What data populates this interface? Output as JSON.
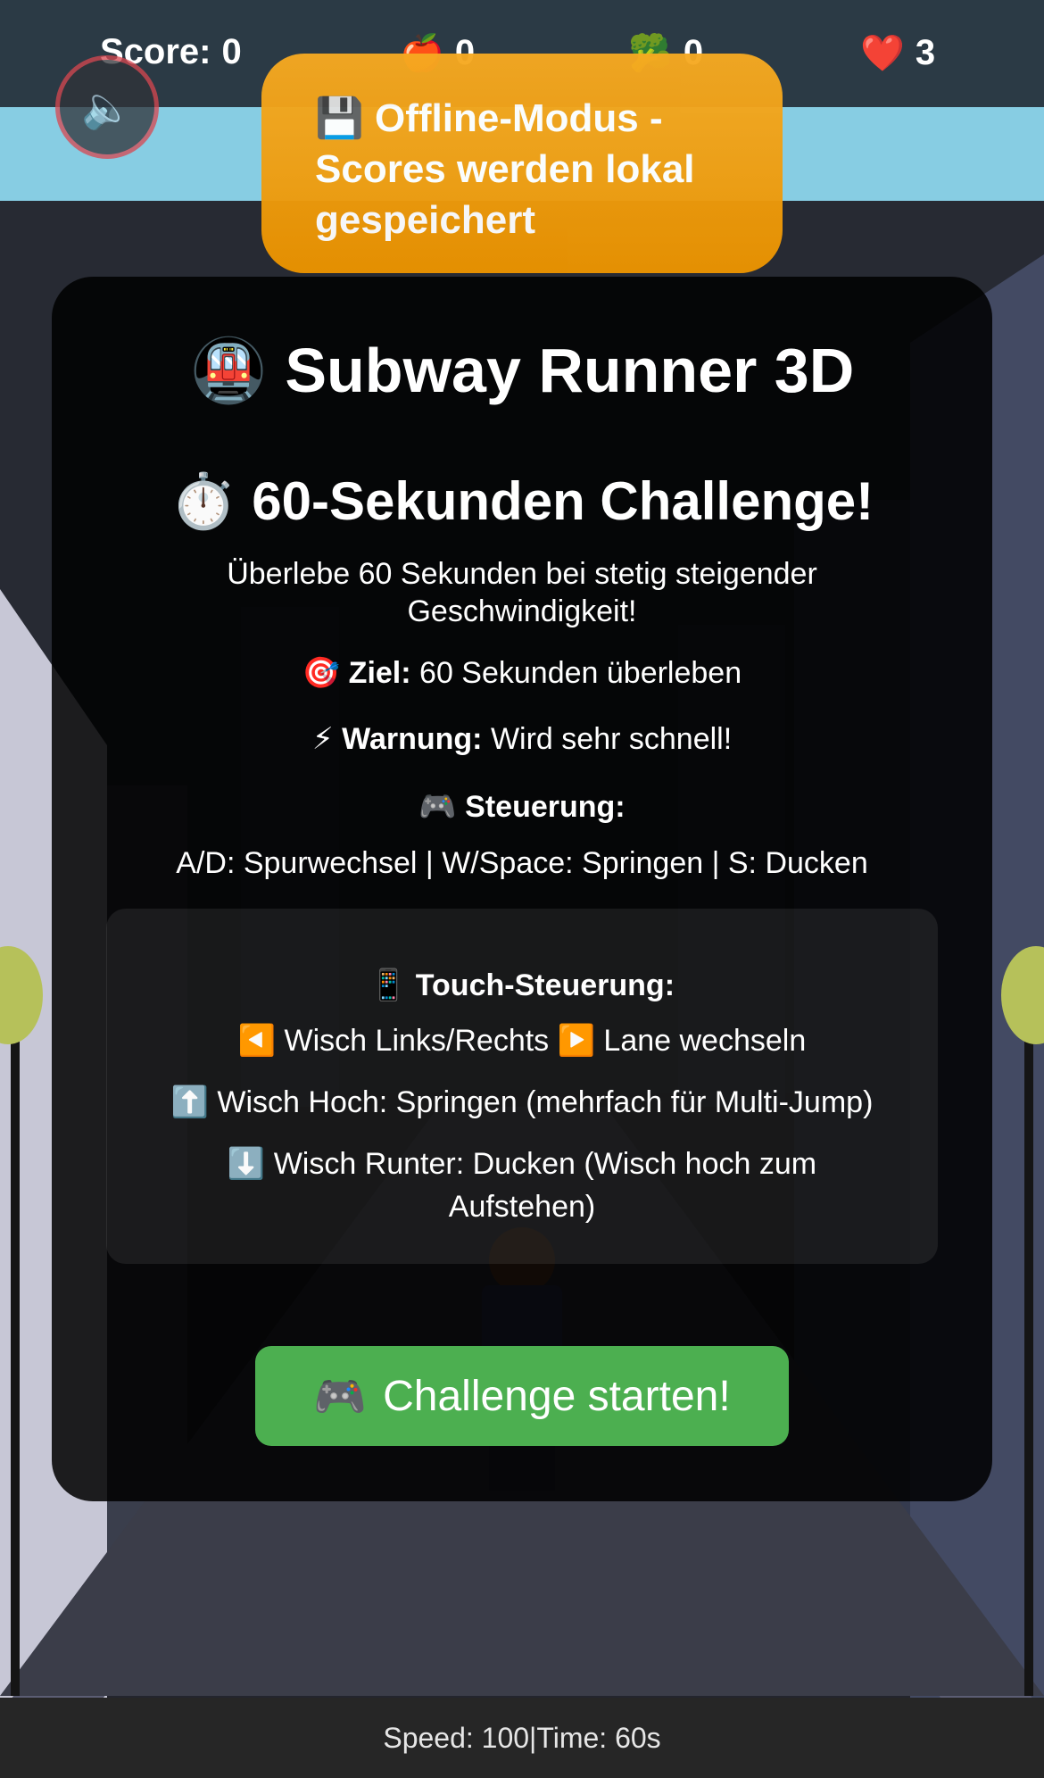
{
  "hud": {
    "score_label": "Score:",
    "score_value": "0",
    "apple_icon": "🍎",
    "apple_count": "0",
    "broccoli_icon": "🥦",
    "broccoli_count": "0",
    "heart_icon": "❤️",
    "lives": "3",
    "mute_icon": "🔈"
  },
  "offline_banner": {
    "icon": "💾",
    "text": "Offline-Modus - Scores werden lokal gespeichert"
  },
  "panel": {
    "title_icon": "🚇",
    "title": "Subway Runner 3D",
    "challenge_icon": "⏱️",
    "challenge": "60-Sekunden Challenge!",
    "description": "Überlebe 60 Sekunden bei stetig steigender Geschwindigkeit!",
    "goal_icon": "🎯",
    "goal_label": "Ziel:",
    "goal_text": "60 Sekunden überleben",
    "warning_icon": "⚡",
    "warning_label": "Warnung:",
    "warning_text": "Wird sehr schnell!",
    "controls_icon": "🎮",
    "controls_label": "Steuerung:",
    "keys_text": "A/D: Spurwechsel | W/Space: Springen | S: Ducken",
    "touch": {
      "icon": "📱",
      "title": "Touch-Steuerung:",
      "left_icon": "◀️",
      "right_icon": "▶️",
      "swipe_lr_a": "Wisch Links/Rechts",
      "swipe_lr_b": "Lane wechseln",
      "up_icon": "⬆️",
      "swipe_up": "Wisch Hoch: Springen (mehrfach für Multi-Jump)",
      "down_icon": "⬇️",
      "swipe_down": "Wisch Runter: Ducken (Wisch hoch zum Aufstehen)"
    },
    "start_icon": "🎮",
    "start_label": "Challenge starten!"
  },
  "status": {
    "text": "Speed: 100|Time: 60s"
  }
}
